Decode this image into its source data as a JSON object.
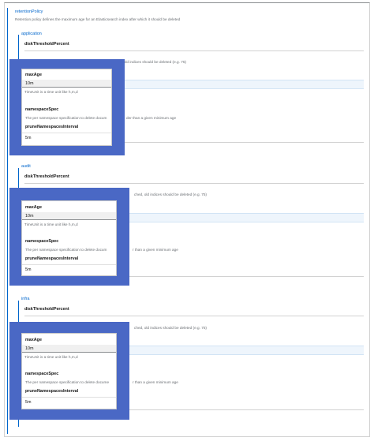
{
  "root": {
    "title": "retentionPolicy",
    "description": "Retention policy defines the maximum age for an Elasticsearch index after which it should be deleted"
  },
  "sections": [
    {
      "name": "application",
      "disk_label": "diskThresholdPercent",
      "disk_desc_visible": "ched, old indices should be deleted (e.g. 75)",
      "max_age_label": "maxAge",
      "max_age_value": "10m",
      "max_age_help": "TimeUnit is a time unit like h,m,d",
      "ns_label": "namespaceSpec",
      "ns_desc_left": "The per namespace specification to delete docum",
      "ns_desc_right": "der than a given minimum age",
      "prune_label": "pruneNamespacesInterval",
      "prune_value": "5m"
    },
    {
      "name": "audit",
      "disk_label": "diskThresholdPercent",
      "disk_desc_visible": "ched, old indices should be deleted (e.g. 75)",
      "max_age_label": "maxAge",
      "max_age_value": "10m",
      "max_age_help": "TimeUnit is a time unit like h,m,d",
      "ns_label": "namespaceSpec",
      "ns_desc_left": "The per namespace specification to delete docum",
      "ns_desc_right": "r than a given minimum age",
      "prune_label": "pruneNamespacesInterval",
      "prune_value": "5m"
    },
    {
      "name": "infra",
      "disk_label": "diskThresholdPercent",
      "disk_desc_visible": "ched, old indices should be deleted (e.g. 75)",
      "max_age_label": "maxAge",
      "max_age_value": "10m",
      "max_age_help": "TimeUnit is a time unit like h,m,d",
      "ns_label": "namespaceSpec",
      "ns_desc_left": "The per namespace specification to delete docume",
      "ns_desc_right": "r than a given minimum age",
      "prune_label": "pruneNamespacesInterval",
      "prune_value": "5m"
    }
  ],
  "colors": {
    "accent": "#0066cc",
    "overlay": "#4a68c5",
    "band": "#eef5fc"
  }
}
